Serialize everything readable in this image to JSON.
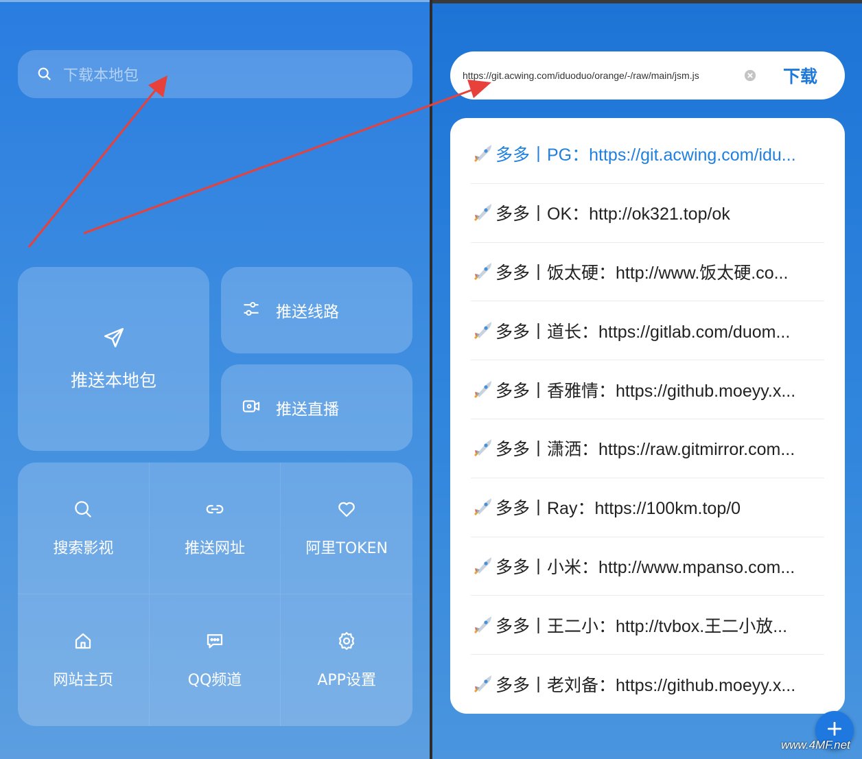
{
  "left": {
    "search_placeholder": "下载本地包",
    "push_local": "推送本地包",
    "push_route": "推送线路",
    "push_live": "推送直播",
    "grid": [
      {
        "label": "搜索影视",
        "icon": "search-icon"
      },
      {
        "label": "推送网址",
        "icon": "link-icon"
      },
      {
        "label": "阿里TOKEN",
        "icon": "heart-icon"
      },
      {
        "label": "网站主页",
        "icon": "home-icon"
      },
      {
        "label": "QQ频道",
        "icon": "chat-icon"
      },
      {
        "label": "APP设置",
        "icon": "gear-icon"
      }
    ]
  },
  "right": {
    "url_value": "https://git.acwing.com/iduoduo/orange/-/raw/main/jsm.js",
    "download_label": "下载",
    "list": [
      "多多丨PG：https://git.acwing.com/idu...",
      "多多丨OK：http://ok321.top/ok",
      "多多丨饭太硬：http://www.饭太硬.co...",
      "多多丨道长：https://gitlab.com/duom...",
      "多多丨香雅情：https://github.moeyy.x...",
      "多多丨潇洒：https://raw.gitmirror.com...",
      "多多丨Ray：https://100km.top/0",
      "多多丨小米：http://www.mpanso.com...",
      "多多丨王二小：http://tvbox.王二小放...",
      "多多丨老刘备：https://github.moeyy.x..."
    ]
  },
  "watermark": "www.4MF.net",
  "colors": {
    "accent": "#1f80e0",
    "arrow": "#e8403a"
  }
}
